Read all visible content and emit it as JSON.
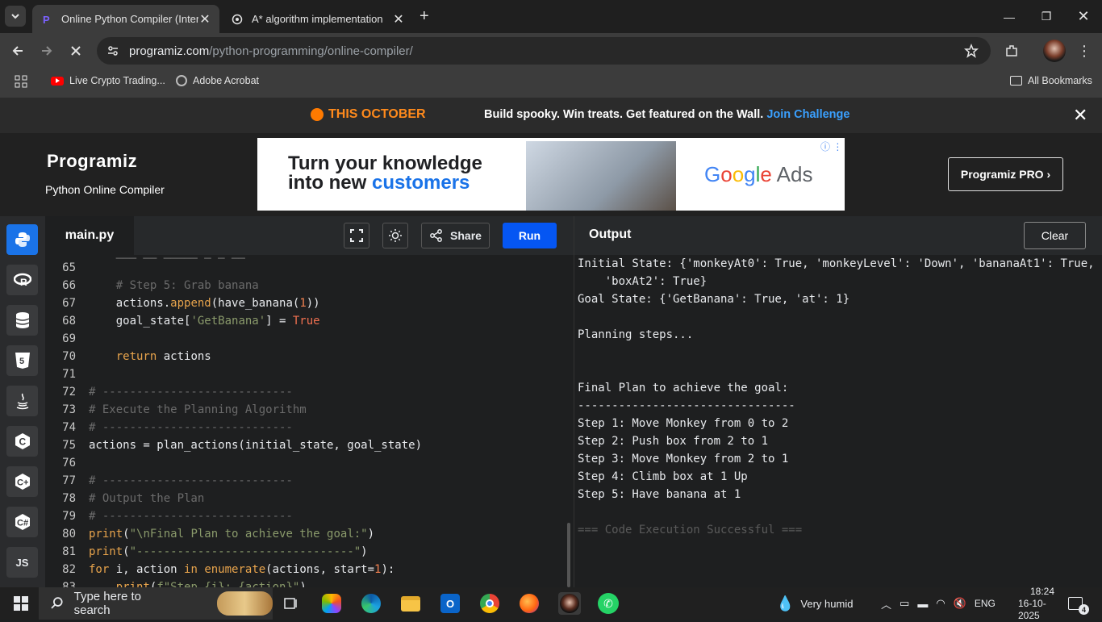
{
  "browser": {
    "tabs": [
      {
        "title": "Online Python Compiler (Interpreter)",
        "active": true
      },
      {
        "title": "A* algorithm implementation",
        "active": false
      }
    ],
    "url_domain": "programiz.com",
    "url_path": "/python-programming/online-compiler/",
    "bookmarks": [
      "Live Crypto Trading...",
      "Adobe Acrobat"
    ],
    "all_bookmarks": "All Bookmarks"
  },
  "banner": {
    "highlight": "THIS OCTOBER",
    "message": "Build spooky. Win treats. Get featured on the Wall.",
    "link": "Join Challenge"
  },
  "header": {
    "logo": "Programiz",
    "subtitle": "Python Online Compiler",
    "pro_button": "Programiz PRO ›"
  },
  "ad": {
    "line1": "Turn your knowledge",
    "line2_prefix": "into new ",
    "line2_highlight": "customers",
    "brand": "Google Ads"
  },
  "rail": {
    "items": [
      "python-icon",
      "r-icon",
      "sql-icon",
      "html5-icon",
      "java-icon",
      "c-icon",
      "cpp-icon",
      "csharp-icon",
      "js-icon"
    ],
    "js_label": "JS"
  },
  "editor": {
    "filename": "main.py",
    "share_label": "Share",
    "run_label": "Run"
  },
  "output": {
    "title": "Output",
    "clear_label": "Clear",
    "lines": [
      "Initial State: {'monkeyAt0': True, 'monkeyLevel': 'Down', 'bananaAt1': True,",
      "    'boxAt2': True}",
      "Goal State: {'GetBanana': True, 'at': 1}",
      "",
      "Planning steps...",
      "",
      "",
      "Final Plan to achieve the goal:",
      "--------------------------------",
      "Step 1: Move Monkey from 0 to 2",
      "Step 2: Push box from 2 to 1",
      "Step 3: Move Monkey from 2 to 1",
      "Step 4: Climb box at 1 Up",
      "Step 5: Have banana at 1",
      "",
      "=== Code Execution Successful ==="
    ]
  },
  "taskbar": {
    "search_placeholder": "Type here to search",
    "weather": "Very humid",
    "lang": "ENG",
    "time": "18:24",
    "date": "16-10-2025",
    "notifications": "4"
  }
}
